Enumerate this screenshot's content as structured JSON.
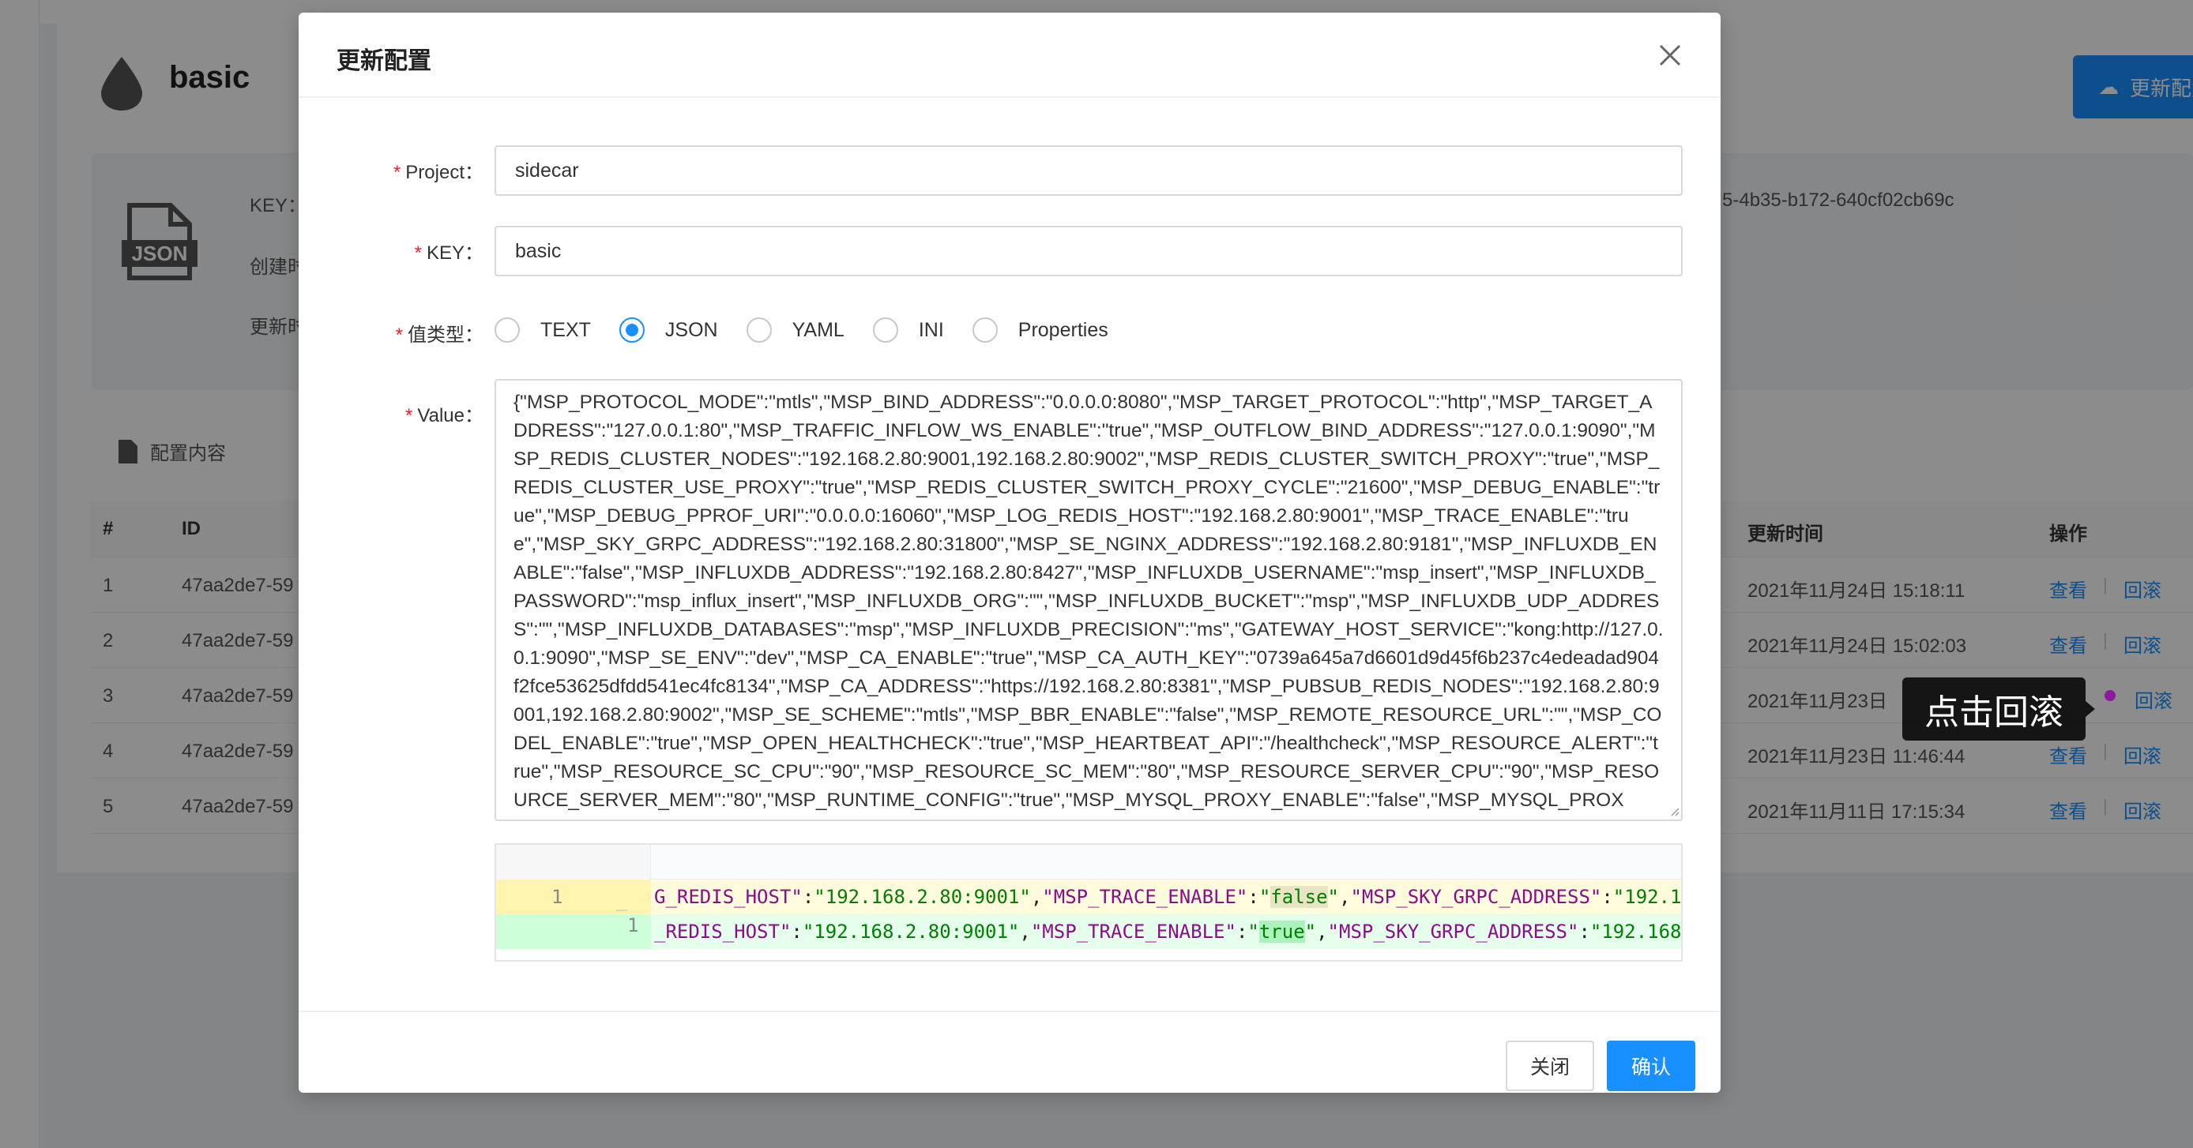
{
  "background": {
    "title": "basic",
    "update_button": "更新配置",
    "info": {
      "key_label": "KEY：",
      "created_label": "创建时",
      "updated_label": "更新时",
      "id_value": "5-4b35-b172-640cf02cb69c"
    },
    "section_title": "配置内容",
    "table": {
      "headers": {
        "num": "#",
        "id": "ID",
        "updated": "更新时间",
        "ops": "操作"
      },
      "rows": [
        {
          "num": "1",
          "id": "47aa2de7-59",
          "time": "2021年11月24日 15:18:11"
        },
        {
          "num": "2",
          "id": "47aa2de7-59",
          "time": "2021年11月24日 15:02:03"
        },
        {
          "num": "3",
          "id": "47aa2de7-59",
          "time": "2021年11月23日"
        },
        {
          "num": "4",
          "id": "47aa2de7-59",
          "time": "2021年11月23日 11:46:44"
        },
        {
          "num": "5",
          "id": "47aa2de7-59",
          "time": "2021年11月11日 17:15:34"
        }
      ],
      "view_label": "查看",
      "rollback_label": "回滚",
      "separator": "|"
    },
    "tooltip": "点击回滚"
  },
  "modal": {
    "title": "更新配置",
    "fields": {
      "project_label": "Project：",
      "project_value": "sidecar",
      "key_label": "KEY：",
      "key_value": "basic",
      "type_label": "值类型：",
      "type_options": [
        "TEXT",
        "JSON",
        "YAML",
        "INI",
        "Properties"
      ],
      "type_selected": "JSON",
      "value_label": "Value：",
      "value_text": "{\"MSP_PROTOCOL_MODE\":\"mtls\",\"MSP_BIND_ADDRESS\":\"0.0.0.0:8080\",\"MSP_TARGET_PROTOCOL\":\"http\",\"MSP_TARGET_ADDRESS\":\"127.0.0.1:80\",\"MSP_TRAFFIC_INFLOW_WS_ENABLE\":\"true\",\"MSP_OUTFLOW_BIND_ADDRESS\":\"127.0.0.1:9090\",\"MSP_REDIS_CLUSTER_NODES\":\"192.168.2.80:9001,192.168.2.80:9002\",\"MSP_REDIS_CLUSTER_SWITCH_PROXY\":\"true\",\"MSP_REDIS_CLUSTER_USE_PROXY\":\"true\",\"MSP_REDIS_CLUSTER_SWITCH_PROXY_CYCLE\":\"21600\",\"MSP_DEBUG_ENABLE\":\"true\",\"MSP_DEBUG_PPROF_URI\":\"0.0.0.0:16060\",\"MSP_LOG_REDIS_HOST\":\"192.168.2.80:9001\",\"MSP_TRACE_ENABLE\":\"true\",\"MSP_SKY_GRPC_ADDRESS\":\"192.168.2.80:31800\",\"MSP_SE_NGINX_ADDRESS\":\"192.168.2.80:9181\",\"MSP_INFLUXDB_ENABLE\":\"false\",\"MSP_INFLUXDB_ADDRESS\":\"192.168.2.80:8427\",\"MSP_INFLUXDB_USERNAME\":\"msp_insert\",\"MSP_INFLUXDB_PASSWORD\":\"msp_influx_insert\",\"MSP_INFLUXDB_ORG\":\"\",\"MSP_INFLUXDB_BUCKET\":\"msp\",\"MSP_INFLUXDB_UDP_ADDRESS\":\"\",\"MSP_INFLUXDB_DATABASES\":\"msp\",\"MSP_INFLUXDB_PRECISION\":\"ms\",\"GATEWAY_HOST_SERVICE\":\"kong:http://127.0.0.1:9090\",\"MSP_SE_ENV\":\"dev\",\"MSP_CA_ENABLE\":\"true\",\"MSP_CA_AUTH_KEY\":\"0739a645a7d6601d9d45f6b237c4edeadad904f2fce53625dfdd541ec4fc8134\",\"MSP_CA_ADDRESS\":\"https://192.168.2.80:8381\",\"MSP_PUBSUB_REDIS_NODES\":\"192.168.2.80:9001,192.168.2.80:9002\",\"MSP_SE_SCHEME\":\"mtls\",\"MSP_BBR_ENABLE\":\"false\",\"MSP_REMOTE_RESOURCE_URL\":\"\",\"MSP_CODEL_ENABLE\":\"true\",\"MSP_OPEN_HEALTHCHECK\":\"true\",\"MSP_HEARTBEAT_API\":\"/healthcheck\",\"MSP_RESOURCE_ALERT\":\"true\",\"MSP_RESOURCE_SC_CPU\":\"90\",\"MSP_RESOURCE_SC_MEM\":\"80\",\"MSP_RESOURCE_SERVER_CPU\":\"90\",\"MSP_RESOURCE_SERVER_MEM\":\"80\",\"MSP_RUNTIME_CONFIG\":\"true\",\"MSP_MYSQL_PROXY_ENABLE\":\"false\",\"MSP_MYSQL_PROX"
    },
    "diff": {
      "del": {
        "line_num": "1",
        "marker": "_",
        "parts": [
          [
            "k",
            "G_REDIS_HOST\""
          ],
          [
            "p",
            ":"
          ],
          [
            "s",
            "\"192.168.2.80:9001\""
          ],
          [
            "p",
            ","
          ],
          [
            "k",
            "\"MSP_TRACE_ENABLE\""
          ],
          [
            "p",
            ":"
          ],
          [
            "s",
            "\""
          ],
          [
            "hd",
            "false"
          ],
          [
            "s",
            "\""
          ],
          [
            "p",
            ","
          ],
          [
            "k",
            "\"MSP_SKY_GRPC_ADDRESS\""
          ],
          [
            "p",
            ":"
          ],
          [
            "s",
            "\"192.1("
          ]
        ]
      },
      "add": {
        "line_num": "1",
        "parts": [
          [
            "k",
            "_REDIS_HOST\""
          ],
          [
            "p",
            ":"
          ],
          [
            "s",
            "\"192.168.2.80:9001\""
          ],
          [
            "p",
            ","
          ],
          [
            "k",
            "\"MSP_TRACE_ENABLE\""
          ],
          [
            "p",
            ":"
          ],
          [
            "s",
            "\""
          ],
          [
            "ha",
            "true"
          ],
          [
            "s",
            "\""
          ],
          [
            "p",
            ","
          ],
          [
            "k",
            "\"MSP_SKY_GRPC_ADDRESS\""
          ],
          [
            "p",
            ":"
          ],
          [
            "s",
            "\"192.168"
          ]
        ]
      }
    },
    "footer": {
      "close_label": "关闭",
      "ok_label": "确认"
    }
  },
  "colors": {
    "primary": "#1890ff",
    "required": "#f5222d",
    "diff_del_bg": "#fffbdd",
    "diff_add_bg": "#e6ffed"
  }
}
